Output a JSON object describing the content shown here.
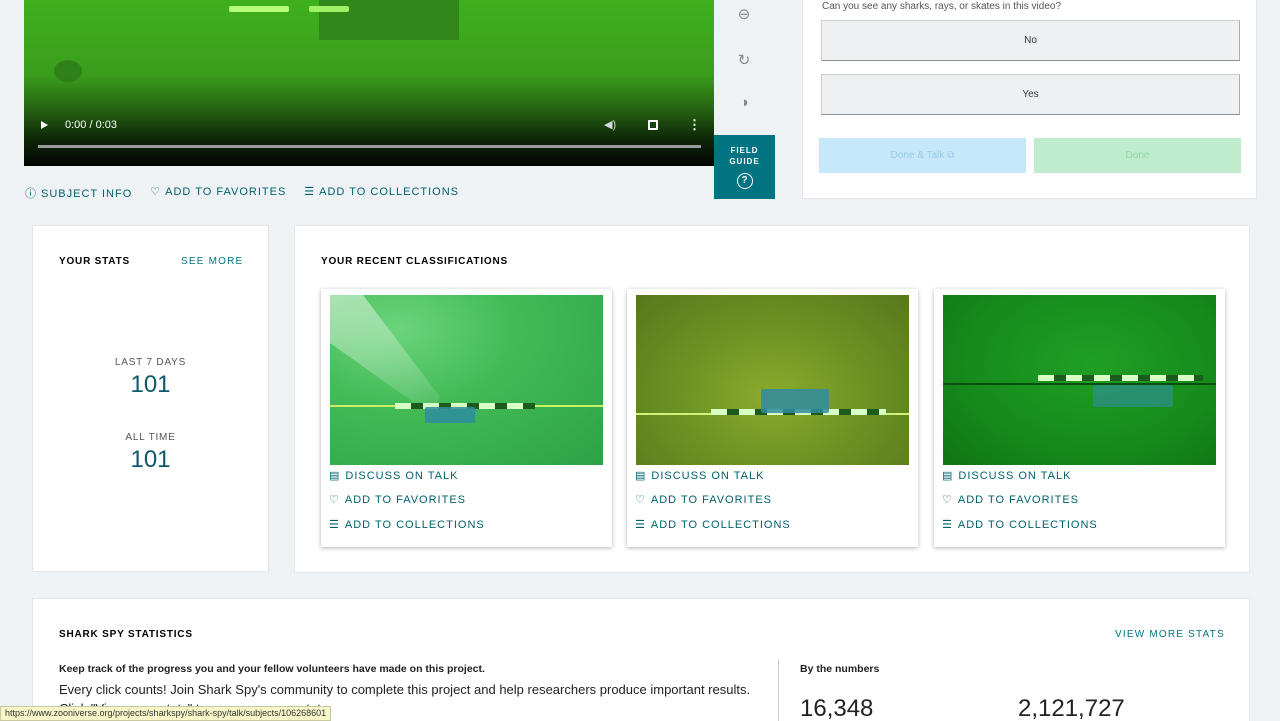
{
  "video": {
    "time": "0:00 / 0:03",
    "icons": [
      "play-icon",
      "volume-icon",
      "fullscreen-icon",
      "more-options-icon"
    ]
  },
  "tools": {
    "field_guide_line1": "FIELD",
    "field_guide_line2": "GUIDE",
    "icons": [
      "zoom-out-icon",
      "rotate-icon",
      "invert-icon",
      "help-icon"
    ]
  },
  "subject_links": {
    "info": "SUBJECT INFO",
    "favorites": "ADD TO FAVORITES",
    "collections": "ADD TO COLLECTIONS"
  },
  "task": {
    "question": "Can you see any sharks, rays, or skates in this video?",
    "answers": [
      "No",
      "Yes"
    ],
    "done_talk": "Done & Talk",
    "done": "Done"
  },
  "your_stats": {
    "title": "YOUR STATS",
    "see_more": "SEE MORE",
    "last7_label": "LAST 7 DAYS",
    "last7_value": "101",
    "all_time_label": "ALL TIME",
    "all_time_value": "101"
  },
  "recent": {
    "title": "YOUR RECENT CLASSIFICATIONS",
    "items": [
      {
        "discuss": "DISCUSS ON TALK",
        "favorites": "ADD TO FAVORITES",
        "collections": "ADD TO COLLECTIONS"
      },
      {
        "discuss": "DISCUSS ON TALK",
        "favorites": "ADD TO FAVORITES",
        "collections": "ADD TO COLLECTIONS"
      },
      {
        "discuss": "DISCUSS ON TALK",
        "favorites": "ADD TO FAVORITES",
        "collections": "ADD TO COLLECTIONS"
      }
    ]
  },
  "project_stats": {
    "title": "SHARK SPY STATISTICS",
    "view_more": "VIEW MORE STATS",
    "lead": "Keep track of the progress you and your fellow volunteers have made on this project.",
    "text": "Every click counts! Join Shark Spy's community to complete this project and help researchers produce important results. Click \"View more stats\" to see even more stats.",
    "by_numbers": "By the numbers",
    "num1": "16,348",
    "num2": "2,121,727"
  },
  "status_bar": {
    "url": "https://www.zooniverse.org/projects/sharkspy/shark-spy/talk/subjects/106268601"
  },
  "colors": {
    "teal": "#007482",
    "link": "#00606e",
    "done_talk_bg": "#c7e8fb",
    "done_bg": "#bfeccd"
  }
}
